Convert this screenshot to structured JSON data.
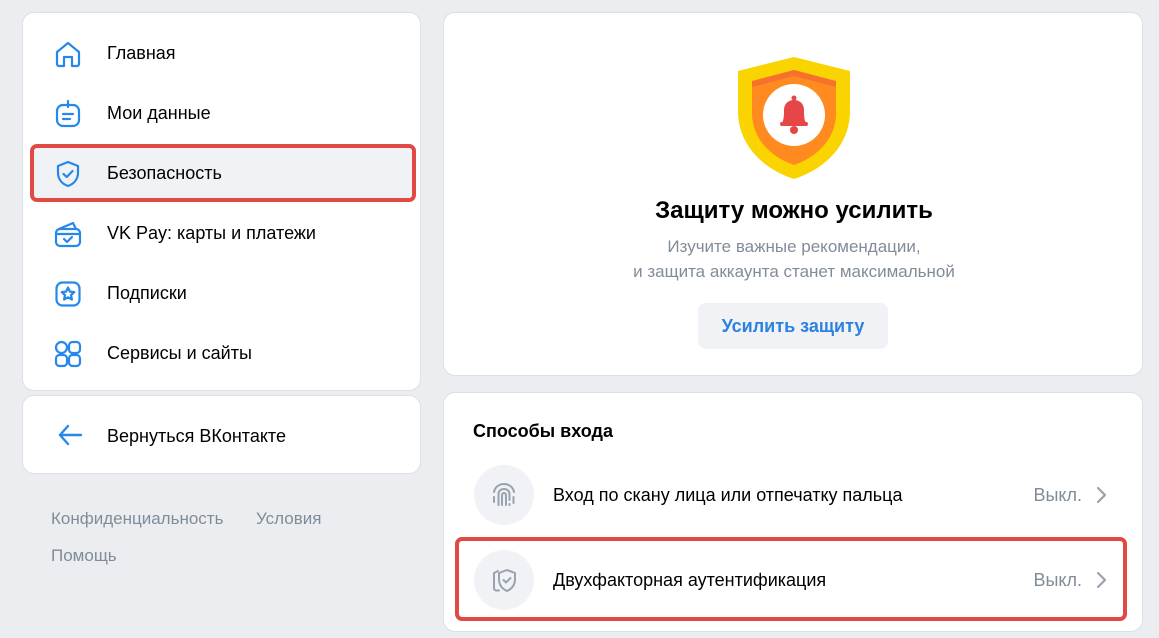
{
  "sidebar": {
    "items": [
      {
        "label": "Главная",
        "icon": "home-icon"
      },
      {
        "label": "Мои данные",
        "icon": "id-card-icon"
      },
      {
        "label": "Безопасность",
        "icon": "shield-check-icon",
        "active": true
      },
      {
        "label": "VK Pay: карты и платежи",
        "icon": "wallet-icon"
      },
      {
        "label": "Подписки",
        "icon": "star-icon"
      },
      {
        "label": "Сервисы и сайты",
        "icon": "services-grid-icon"
      }
    ],
    "back_label": "Вернуться ВКонтакте"
  },
  "footer": {
    "privacy": "Конфиденциальность",
    "terms": "Условия",
    "help": "Помощь"
  },
  "hero": {
    "title": "Защиту можно усилить",
    "subtitle_line1": "Изучите важные рекомендации,",
    "subtitle_line2": "и защита аккаунта станет максимальной",
    "button_label": "Усилить защиту"
  },
  "login_methods": {
    "title": "Способы входа",
    "rows": [
      {
        "label": "Вход по скану лица или отпечатку пальца",
        "status": "Выкл.",
        "icon": "fingerprint-icon"
      },
      {
        "label": "Двухфакторная аутентификация",
        "status": "Выкл.",
        "icon": "phone-shield-icon"
      }
    ]
  },
  "colors": {
    "accent": "#2d81e0",
    "icon_blue": "#2688eb",
    "highlight": "#e04a44",
    "shield_yellow": "#fad400",
    "shield_orange": "#ff8a1f",
    "bell_red": "#e64646",
    "muted_text": "#818c99",
    "background": "#ebedf0"
  }
}
